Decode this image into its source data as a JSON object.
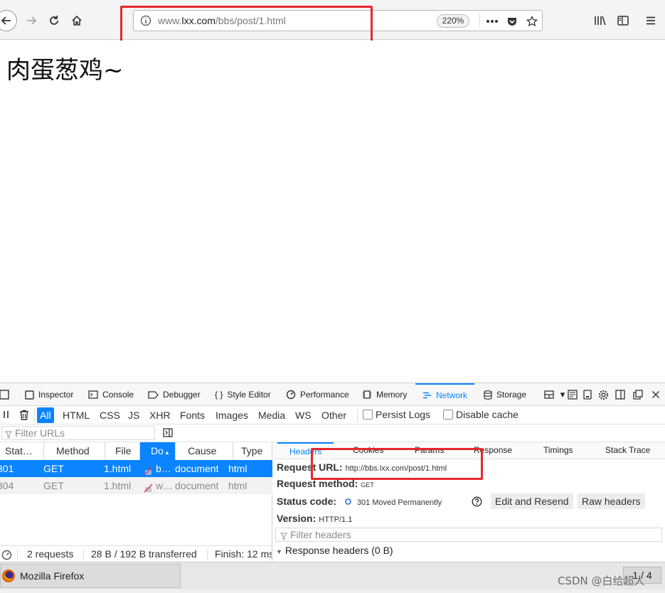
{
  "browser": {
    "url_prefix": "www.",
    "url_host": "lxx.com",
    "url_path": "/bbs/post/1.html",
    "zoom": "220%"
  },
  "page": {
    "heading": "肉蛋葱鸡~"
  },
  "devtools": {
    "tabs": [
      {
        "label": "Inspector"
      },
      {
        "label": "Console"
      },
      {
        "label": "Debugger"
      },
      {
        "label": "Style Editor"
      },
      {
        "label": "Performance"
      },
      {
        "label": "Memory"
      },
      {
        "label": "Network"
      },
      {
        "label": "Storage"
      }
    ],
    "filter_types": [
      "All",
      "HTML",
      "CSS",
      "JS",
      "XHR",
      "Fonts",
      "Images",
      "Media",
      "WS",
      "Other"
    ],
    "persist_logs": "Persist Logs",
    "disable_cache": "Disable cache",
    "filter_urls_placeholder": "Filter URLs",
    "columns": [
      "Stat…",
      "Method",
      "File",
      "Do",
      "Cause",
      "Type"
    ],
    "requests": [
      {
        "status": "301",
        "method": "GET",
        "file": "1.html",
        "domain": "b…",
        "cause": "document",
        "type": "html"
      },
      {
        "status": "304",
        "method": "GET",
        "file": "1.html",
        "domain": "w…",
        "cause": "document",
        "type": "html"
      }
    ],
    "status_bar": {
      "requests": "2 requests",
      "transferred": "28 B / 192 B transferred",
      "finish": "Finish: 12 ms"
    },
    "details_tabs": [
      "Headers",
      "Cookies",
      "Params",
      "Response",
      "Timings",
      "Stack Trace"
    ],
    "request_url_label": "Request URL:",
    "request_url": "http://bbs.lxx.com/post/1.html",
    "request_method_label": "Request method:",
    "request_method": "GET",
    "status_code_label": "Status code:",
    "status_code": "301 Moved Permanently",
    "edit_resend": "Edit and Resend",
    "raw_headers": "Raw headers",
    "version_label": "Version:",
    "version": "HTTP/1.1",
    "filter_headers_placeholder": "Filter headers",
    "response_headers": "Response headers (0 B)"
  },
  "taskbar": {
    "app": "Mozilla Firefox",
    "page_indicator": "1 / 4"
  },
  "watermark": "CSDN @白给超人",
  "colors": {
    "accent": "#0a84ff",
    "highlight": "#e8272b"
  }
}
